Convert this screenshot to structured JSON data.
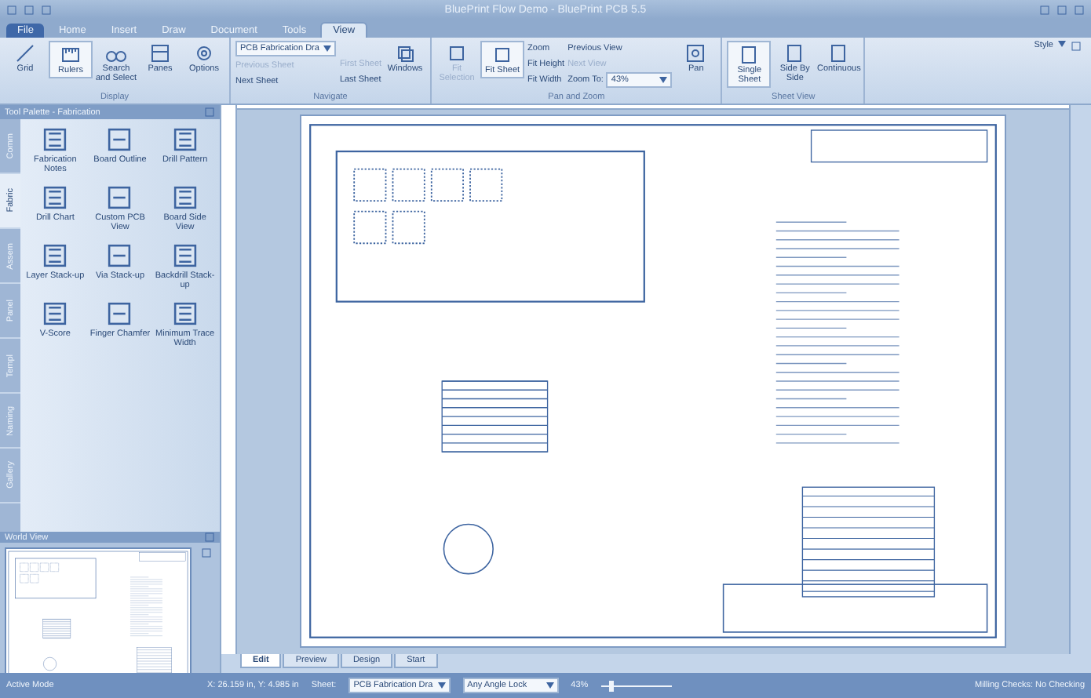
{
  "window": {
    "title": "BluePrint Flow Demo - BluePrint PCB 5.5",
    "style_menu": "Style"
  },
  "ribbon_tabs": [
    {
      "label": "File",
      "selected": false
    },
    {
      "label": "Home",
      "selected": false
    },
    {
      "label": "Insert",
      "selected": false
    },
    {
      "label": "Draw",
      "selected": false
    },
    {
      "label": "Document",
      "selected": false
    },
    {
      "label": "Tools",
      "selected": false
    },
    {
      "label": "View",
      "selected": true
    }
  ],
  "display_group": {
    "label": "Display",
    "buttons": [
      {
        "label": "Grid",
        "selected": false
      },
      {
        "label": "Rulers",
        "selected": true
      },
      {
        "label": "Search and Select",
        "selected": false
      },
      {
        "label": "Panes",
        "selected": false
      },
      {
        "label": "Options",
        "selected": false
      }
    ]
  },
  "navigate_group": {
    "label": "Navigate",
    "sheet_select": "PCB Fabrication Dra",
    "small_buttons": [
      {
        "label": "Previous Sheet",
        "disabled": true
      },
      {
        "label": "Next Sheet",
        "disabled": false
      },
      {
        "label": "First Sheet",
        "disabled": true
      },
      {
        "label": "Last Sheet",
        "disabled": false
      }
    ],
    "windows_button": "Windows"
  },
  "pan_zoom_group": {
    "label": "Pan and Zoom",
    "large_buttons": [
      {
        "label": "Fit Selection",
        "disabled": true,
        "selected": false
      },
      {
        "label": "Fit Sheet",
        "disabled": false,
        "selected": true
      }
    ],
    "small_buttons": [
      {
        "label": "Zoom",
        "disabled": false
      },
      {
        "label": "Fit Height",
        "disabled": false
      },
      {
        "label": "Fit Width",
        "disabled": false
      },
      {
        "label": "Previous View",
        "disabled": false
      },
      {
        "label": "Next View",
        "disabled": true
      }
    ],
    "zoom_to_label": "Zoom To:",
    "zoom_to_value": "43%",
    "pan_button": "Pan"
  },
  "sheet_view_group": {
    "label": "Sheet View",
    "buttons": [
      {
        "label": "Single Sheet",
        "selected": true
      },
      {
        "label": "Side By Side",
        "selected": false
      },
      {
        "label": "Continuous",
        "selected": false
      }
    ]
  },
  "tool_palette": {
    "title": "Tool Palette - Fabrication",
    "side_tabs": [
      {
        "label": "Comm",
        "selected": false
      },
      {
        "label": "Fabric",
        "selected": true
      },
      {
        "label": "Assem",
        "selected": false
      },
      {
        "label": "Panel",
        "selected": false
      },
      {
        "label": "Templ",
        "selected": false
      },
      {
        "label": "Naming",
        "selected": false
      },
      {
        "label": "Gallery",
        "selected": false
      }
    ],
    "tools": [
      "Fabrication Notes",
      "Board Outline",
      "Drill Pattern",
      "Drill Chart",
      "Custom PCB View",
      "Board Side View",
      "Layer Stack-up",
      "Via Stack-up",
      "Backdrill Stack-up",
      "V-Score",
      "Finger Chamfer",
      "Minimum Trace Width"
    ]
  },
  "world_view": {
    "title": "World View"
  },
  "document_tabs": [
    {
      "label": "Edit",
      "selected": true
    },
    {
      "label": "Preview",
      "selected": false
    },
    {
      "label": "Design",
      "selected": false
    },
    {
      "label": "Start",
      "selected": false
    }
  ],
  "status_bar": {
    "mode": "Active Mode",
    "coordinates": "X: 26.159 in, Y: 4.985 in",
    "sheet_label": "Sheet:",
    "sheet_value": "PCB Fabrication Dra",
    "angle_lock": "Any Angle Lock",
    "zoom": "43%",
    "zoom_slider": {
      "level": 0.12
    },
    "milling": "Milling Checks: No Checking"
  }
}
